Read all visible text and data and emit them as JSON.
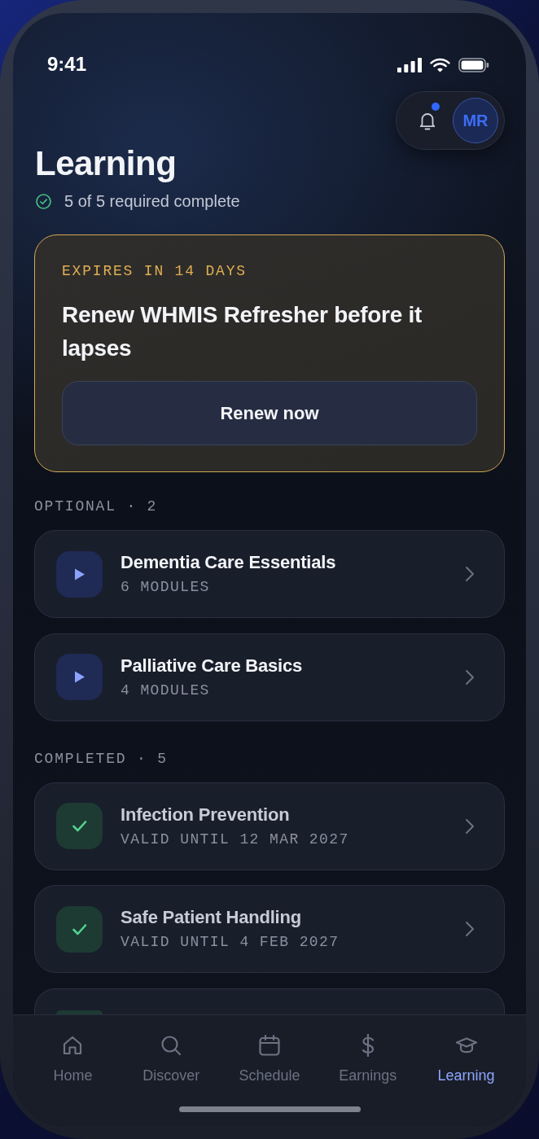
{
  "status_bar": {
    "time": "9:41"
  },
  "header": {
    "notifications": {
      "unread": true
    },
    "avatar": {
      "initials": "MR"
    }
  },
  "page": {
    "title": "Learning",
    "summary": "5 of 5 required complete"
  },
  "alert": {
    "eyebrow": "EXPIRES IN 14 DAYS",
    "title": "Renew WHMIS Refresher before it lapses",
    "button": "Renew now"
  },
  "sections": [
    {
      "label": "OPTIONAL · 2",
      "items": [
        {
          "kind": "optional",
          "title": "Dementia Care Essentials",
          "subtitle": "6 MODULES"
        },
        {
          "kind": "optional",
          "title": "Palliative Care Basics",
          "subtitle": "4 MODULES"
        }
      ]
    },
    {
      "label": "COMPLETED · 5",
      "items": [
        {
          "kind": "completed",
          "title": "Infection Prevention",
          "subtitle": "VALID UNTIL 12 MAR 2027"
        },
        {
          "kind": "completed",
          "title": "Safe Patient Handling",
          "subtitle": "VALID UNTIL 4 FEB 2027"
        },
        {
          "kind": "completed"
        }
      ]
    }
  ],
  "tab_bar": {
    "tabs": [
      {
        "label": "Home",
        "selected": false
      },
      {
        "label": "Discover",
        "selected": false
      },
      {
        "label": "Schedule",
        "selected": false
      },
      {
        "label": "Earnings",
        "selected": false
      },
      {
        "label": "Learning",
        "selected": true
      }
    ]
  }
}
